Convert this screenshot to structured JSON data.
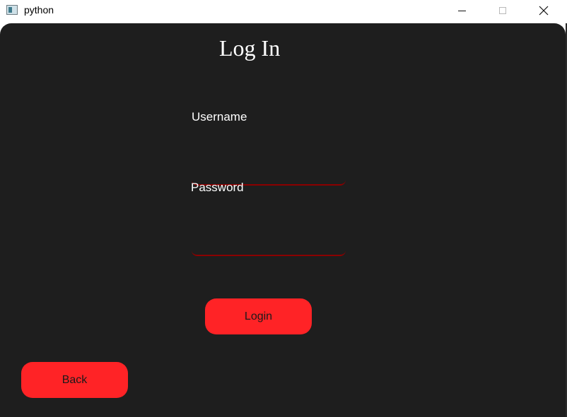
{
  "window": {
    "title": "python",
    "icons": {
      "app": "app-icon",
      "minimize": "minimize-icon",
      "maximize": "maximize-icon",
      "close": "close-icon"
    }
  },
  "form": {
    "title": "Log In",
    "username_label": "Username",
    "username_value": "",
    "password_label": "Password",
    "password_value": "",
    "login_label": "Login",
    "back_label": "Back"
  },
  "colors": {
    "background": "#1e1e1e",
    "accent": "#ff2326",
    "field_underline": "#8b0000",
    "text": "#ffffff"
  }
}
